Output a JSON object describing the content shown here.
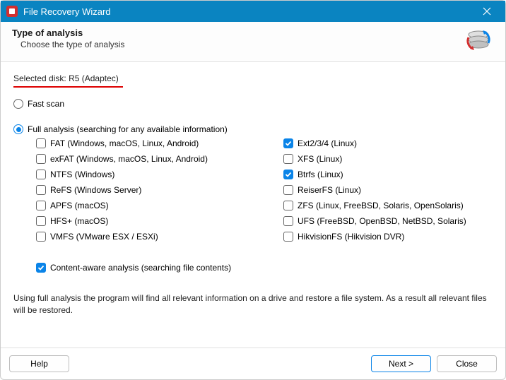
{
  "window": {
    "title": "File Recovery Wizard"
  },
  "header": {
    "title": "Type of analysis",
    "subtitle": "Choose the type of analysis"
  },
  "selectedDiskLabel": "Selected disk:",
  "selectedDiskValue": "R5 (Adaptec)",
  "modes": {
    "fast": {
      "label": "Fast scan",
      "selected": false
    },
    "full": {
      "label": "Full analysis (searching for any available information)",
      "selected": true
    }
  },
  "filesystems": {
    "left": [
      {
        "label": "FAT (Windows, macOS, Linux, Android)",
        "checked": false
      },
      {
        "label": "exFAT (Windows, macOS, Linux, Android)",
        "checked": false
      },
      {
        "label": "NTFS (Windows)",
        "checked": false
      },
      {
        "label": "ReFS (Windows Server)",
        "checked": false
      },
      {
        "label": "APFS (macOS)",
        "checked": false
      },
      {
        "label": "HFS+ (macOS)",
        "checked": false
      },
      {
        "label": "VMFS (VMware ESX / ESXi)",
        "checked": false
      }
    ],
    "right": [
      {
        "label": "Ext2/3/4 (Linux)",
        "checked": true
      },
      {
        "label": "XFS (Linux)",
        "checked": false
      },
      {
        "label": "Btrfs (Linux)",
        "checked": true
      },
      {
        "label": "ReiserFS (Linux)",
        "checked": false
      },
      {
        "label": "ZFS (Linux, FreeBSD, Solaris, OpenSolaris)",
        "checked": false
      },
      {
        "label": "UFS (FreeBSD, OpenBSD, NetBSD, Solaris)",
        "checked": false
      },
      {
        "label": "HikvisionFS (Hikvision DVR)",
        "checked": false
      }
    ]
  },
  "contentAware": {
    "label": "Content-aware analysis (searching file contents)",
    "checked": true
  },
  "description": "Using full analysis the program will find all relevant information on a drive and restore a file system. As a result all relevant files will be restored.",
  "buttons": {
    "help": "Help",
    "next": "Next >",
    "close": "Close"
  }
}
